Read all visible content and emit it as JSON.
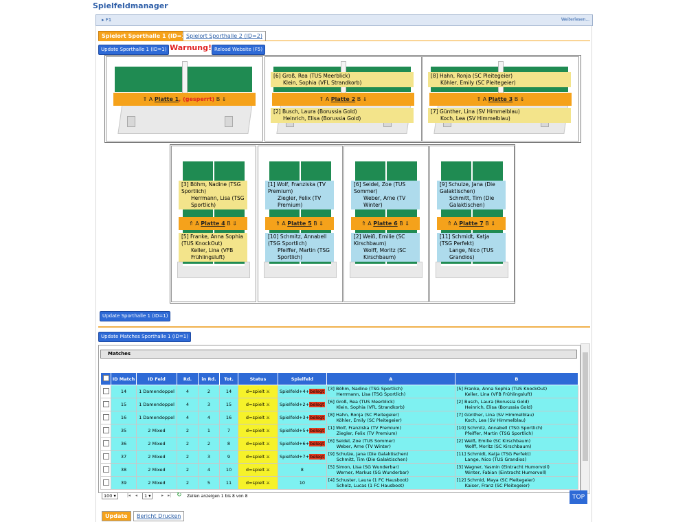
{
  "app_title": "Spielfeldmanager",
  "f1": {
    "label": "F1",
    "more": "Weiterlesen..."
  },
  "tabs": [
    "Spielort Sporthalle 1 (ID=1)",
    "Spielort Sporthalle 2 (ID=2)"
  ],
  "buttons": {
    "update_hall": "Update Sporthalle 1 (ID=1)",
    "warning": "Warnung!",
    "reload": "Reload Website (F5)",
    "update_hall_bottom": "Update Sporthalle 1 (ID=1)",
    "update_matches": "Update Matches Sporthalle 1 (ID=1)"
  },
  "tables": [
    {
      "name": "Platte 1",
      "locked": "(gesperrt)",
      "top": [],
      "bottom": [],
      "color": ""
    },
    {
      "name": "Platte 2",
      "top": [
        "[6] Groß, Rea (TUS Meerblick)",
        "Klein, Sophia (VFL Strandkorb)"
      ],
      "bottom": [
        "[2] Busch, Laura (Borussia Gold)",
        "Heinrich, Elisa (Borussia Gold)"
      ],
      "color": "yellow"
    },
    {
      "name": "Platte 3",
      "top": [
        "[8] Hahn, Ronja (SC Pleitegeier)",
        "Köhler, Emily (SC Pleitegeier)"
      ],
      "bottom": [
        "[7] Günther, Lina (SV Himmelblau)",
        "Koch, Lea (SV Himmelblau)"
      ],
      "color": "yellow"
    },
    {
      "name": "Platte 4",
      "top": [
        "[3] Böhm, Nadine (TSG Sportlich)",
        "Herrmann, Lisa (TSG Sportlich)"
      ],
      "bottom": [
        "[5] Franke, Anna Sophia (TUS KnockOut)",
        "Keller, Lina (VFB Frühlingsluft)"
      ],
      "color": "yellow"
    },
    {
      "name": "Platte 5",
      "top": [
        "[1] Wolf, Franziska (TV Premium)",
        "Ziegler, Felix (TV Premium)"
      ],
      "bottom": [
        "[10] Schmitz, Annabell (TSG Sportlich)",
        "Pfeiffer, Martin (TSG Sportlich)"
      ],
      "color": "blue"
    },
    {
      "name": "Platte 6",
      "top": [
        "[6] Seidel, Zoe (TUS Sommer)",
        "Weber, Arne (TV Winter)"
      ],
      "bottom": [
        "[2] Weiß, Emilie (SC Kirschbaum)",
        "Wolff, Moritz (SC Kirschbaum)"
      ],
      "color": "blue"
    },
    {
      "name": "Platte 7",
      "top": [
        "[9] Schulze, Jana (Die Galaktischen)",
        "Schmitt, Tim (Die Galaktischen)"
      ],
      "bottom": [
        "[11] Schmidt, Katja (TSG Perfekt)",
        "Lange, Nico (TUS Grandios)"
      ],
      "color": "blue"
    }
  ],
  "bar_a": "⇑ A",
  "bar_b": "B ⇓",
  "matches": {
    "caption": "Matches",
    "columns": [
      "ID Match",
      "ID Feld",
      "Rd.",
      "in Rd.",
      "Tot.",
      "Status",
      "Spielfeld",
      "A",
      "B"
    ],
    "rows": [
      {
        "id": "14",
        "feld": "1 Damendoppel",
        "rd": "4",
        "inrd": "2",
        "tot": "14",
        "status": "d=spielt ⚔",
        "spielfeld": "Spielfeld+4+",
        "beleg": "belegt",
        "a": [
          "[3] Böhm, Nadine (TSG Sportlich)",
          "Herrmann, Lisa (TSG Sportlich)"
        ],
        "b": [
          "[5] Franke, Anna Sophia (TUS KnockOut)",
          "Keller, Lina (VFB Frühlingsluft)"
        ]
      },
      {
        "id": "15",
        "feld": "1 Damendoppel",
        "rd": "4",
        "inrd": "3",
        "tot": "15",
        "status": "d=spielt ⚔",
        "spielfeld": "Spielfeld+2+",
        "beleg": "belegt",
        "a": [
          "[6] Groß, Rea (TUS Meerblick)",
          "Klein, Sophia (VFL Strandkorb)"
        ],
        "b": [
          "[2] Busch, Laura (Borussia Gold)",
          "Heinrich, Elisa (Borussia Gold)"
        ]
      },
      {
        "id": "16",
        "feld": "1 Damendoppel",
        "rd": "4",
        "inrd": "4",
        "tot": "16",
        "status": "d=spielt ⚔",
        "spielfeld": "Spielfeld+3+",
        "beleg": "belegt",
        "a": [
          "[8] Hahn, Ronja (SC Pleitegeier)",
          "Köhler, Emily (SC Pleitegeier)"
        ],
        "b": [
          "[7] Günther, Lina (SV Himmelblau)",
          "Koch, Lea (SV Himmelblau)"
        ]
      },
      {
        "id": "35",
        "feld": "2 Mixed",
        "rd": "2",
        "inrd": "1",
        "tot": "7",
        "status": "d=spielt ⚔",
        "spielfeld": "Spielfeld+5+",
        "beleg": "belegt",
        "a": [
          "[1] Wolf, Franziska (TV Premium)",
          "Ziegler, Felix (TV Premium)"
        ],
        "b": [
          "[10] Schmitz, Annabell (TSG Sportlich)",
          "Pfeiffer, Martin (TSG Sportlich)"
        ]
      },
      {
        "id": "36",
        "feld": "2 Mixed",
        "rd": "2",
        "inrd": "2",
        "tot": "8",
        "status": "d=spielt ⚔",
        "spielfeld": "Spielfeld+6+",
        "beleg": "belegt",
        "a": [
          "[6] Seidel, Zoe (TUS Sommer)",
          "Weber, Arne (TV Winter)"
        ],
        "b": [
          "[2] Weiß, Emilie (SC Kirschbaum)",
          "Wolff, Moritz (SC Kirschbaum)"
        ]
      },
      {
        "id": "37",
        "feld": "2 Mixed",
        "rd": "2",
        "inrd": "3",
        "tot": "9",
        "status": "d=spielt ⚔",
        "spielfeld": "Spielfeld+7+",
        "beleg": "belegt",
        "a": [
          "[9] Schulze, Jana (Die Galaktischen)",
          "Schmitt, Tim (Die Galaktischen)"
        ],
        "b": [
          "[11] Schmidt, Katja (TSG Perfekt)",
          "Lange, Nico (TUS Grandios)"
        ]
      },
      {
        "id": "38",
        "feld": "2 Mixed",
        "rd": "2",
        "inrd": "4",
        "tot": "10",
        "status": "d=spielt ⚔",
        "spielfeld": "8",
        "beleg": "",
        "a": [
          "[5] Simon, Lisa (SG Wunderbar)",
          "Werner, Markus (SG Wunderbar)"
        ],
        "b": [
          "[3] Wagner, Yasmin (Eintracht Humorvoll)",
          "Winter, Fabian (Eintracht Humorvoll)"
        ]
      },
      {
        "id": "39",
        "feld": "2 Mixed",
        "rd": "2",
        "inrd": "5",
        "tot": "11",
        "status": "d=spielt ⚔",
        "spielfeld": "10",
        "beleg": "",
        "a": [
          "[4] Schuster, Laura (1 FC Hausboot)",
          "Scholz, Lucas (1 FC Hausboot)"
        ],
        "b": [
          "[12] Schmid, Maya (SC Pleitegeier)",
          "Kaiser, Franz (SC Pleitegeier)"
        ]
      }
    ]
  },
  "pager": {
    "page_size": "100",
    "page": "1",
    "info": "Zeilen anzeigen 1 bis 8 von 8"
  },
  "top_label": "TOP",
  "bottom_tabs": [
    "Update",
    "Bericht Drucken"
  ]
}
